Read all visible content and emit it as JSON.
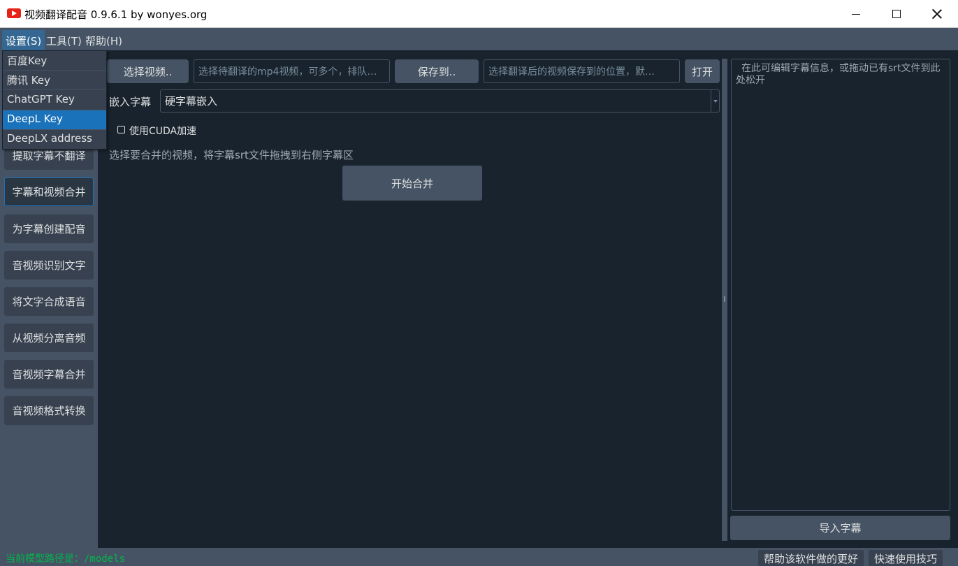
{
  "window": {
    "title": "视频翻译配音 0.9.6.1 by wonyes.org"
  },
  "menubar": {
    "items": [
      {
        "label": "设置(S)"
      },
      {
        "label": "工具(T)"
      },
      {
        "label": "帮助(H)"
      }
    ]
  },
  "settings_menu": {
    "items": [
      {
        "label": "百度Key"
      },
      {
        "label": "腾讯 Key"
      },
      {
        "label": "ChatGPT Key"
      },
      {
        "label": "DeepL Key"
      },
      {
        "label": "DeepLX address"
      }
    ],
    "highlighted_index": 3
  },
  "sidebar": {
    "items": [
      {
        "label": "提取字幕不翻译"
      },
      {
        "label": "字幕和视频合并"
      },
      {
        "label": "为字幕创建配音"
      },
      {
        "label": "音视频识别文字"
      },
      {
        "label": "将文字合成语音"
      },
      {
        "label": "从视频分离音频"
      },
      {
        "label": "音视频字幕合并"
      },
      {
        "label": "音视频格式转换"
      }
    ],
    "active_index": 1
  },
  "main": {
    "select_video_label": "选择视频..",
    "video_path_placeholder": "选择待翻译的mp4视频，可多个，排队…",
    "save_to_label": "保存到..",
    "save_path_placeholder": "选择翻译后的视频保存到的位置，默…",
    "open_label": "打开",
    "embed_subtitle_label": "嵌入字幕",
    "embed_subtitle_value": "硬字幕嵌入",
    "cuda_label": "使用CUDA加速",
    "cuda_checked": false,
    "hint": "选择要合并的视频，将字幕srt文件拖拽到右侧字幕区",
    "start_label": "开始合并"
  },
  "right_panel": {
    "subtitle_placeholder": "在此可编辑字幕信息，或拖动已有srt文件到此处松开",
    "import_label": "导入字幕"
  },
  "statusbar": {
    "model_path": "当前模型路径是：/models",
    "help_link": "帮助该软件做的更好",
    "tips_link": "快速使用技巧"
  }
}
